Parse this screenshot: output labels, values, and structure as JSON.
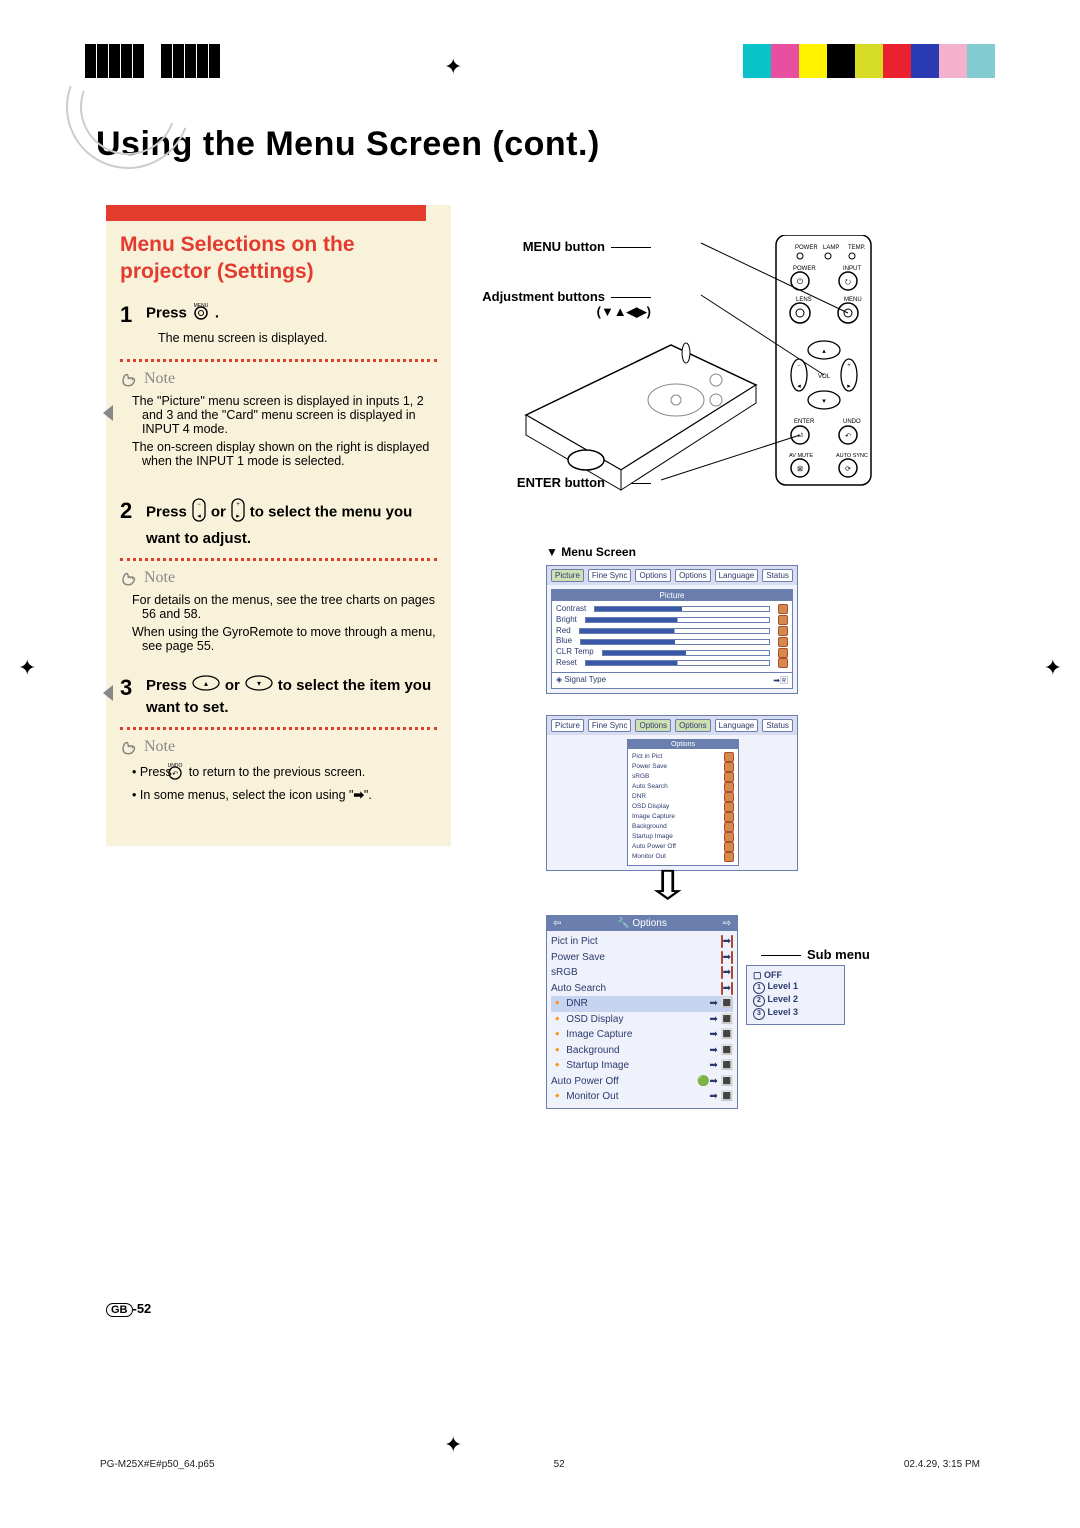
{
  "registration_colors": [
    "#0ac3c8",
    "#e84fa1",
    "#fff200",
    "#000000",
    "#d7dd27",
    "#ea212e",
    "#2a3ab2",
    "#f4b1cb",
    "#82cbd0"
  ],
  "page_title": "Using the Menu Screen (cont.)",
  "section_title": "Menu Selections on the projector (Settings)",
  "step1": {
    "label": "Press ",
    "button_alt": "MENU",
    "after": ".",
    "bullet1": "The menu screen is displayed."
  },
  "note_label": "Note",
  "step1_notes": [
    "The \"Picture\" menu screen is displayed in inputs 1, 2 and 3 and the \"Card\" menu screen is displayed in INPUT 4 mode.",
    "The on-screen display shown on the right is displayed when the INPUT 1 mode is selected."
  ],
  "step2": {
    "pre": "Press ",
    "mid": " or ",
    "post": " to select the menu you want to adjust."
  },
  "step2_notes": [
    "For details on the menus, see the tree charts on pages 56 and 58.",
    "When using the GyroRemote to move through a menu, see page 55."
  ],
  "step3": {
    "pre": "Press ",
    "mid": " or ",
    "post": " to select the item you want to set."
  },
  "step3_notes_a": "Press ",
  "step3_notes_a_alt": "UNDO",
  "step3_notes_a_post": " to return to the previous screen.",
  "step3_notes_b_pre": "In some menus, select the icon using \"",
  "step3_notes_b_post": "\".",
  "right_labels": {
    "menu": "MENU button",
    "adj": "Adjustment buttons",
    "adj_glyphs": "(▼▲◀▶)",
    "enter": "ENTER button",
    "menu_screen": "▼ Menu Screen",
    "submenu": "Sub menu"
  },
  "menu1": {
    "tabs": [
      "Picture",
      "Fine Sync",
      "Options",
      "Options",
      "Language",
      "Status"
    ],
    "active": "Picture",
    "items": [
      "Contrast",
      "Bright",
      "Red",
      "Blue",
      "CLR Temp",
      "Reset"
    ],
    "footer": "Signal Type"
  },
  "menu2": {
    "tabs": [
      "Picture",
      "Fine Sync",
      "Options",
      "Options",
      "Language",
      "Status"
    ],
    "active": "Options",
    "items": [
      "Pict in Pict",
      "Power Save",
      "sRGB",
      "Auto Search",
      "DNR",
      "OSD Display",
      "Image Capture",
      "Background",
      "Startup Image",
      "Auto Power Off",
      "Monitor Out"
    ]
  },
  "menu3": {
    "title": "Options",
    "items": [
      "Pict in Pict",
      "Power Save",
      "sRGB",
      "Auto Search",
      "DNR",
      "OSD Display",
      "Image Capture",
      "Background",
      "Startup Image",
      "Auto Power Off",
      "Monitor Out"
    ]
  },
  "submenu": {
    "items": [
      "OFF",
      "Level 1",
      "Level 2",
      "Level 3"
    ]
  },
  "page_number_label": "-52",
  "page_number_prefix": "GB",
  "footer": {
    "file": "PG-M25X#E#p50_64.p65",
    "page": "52",
    "datetime": "02.4.29, 3:15 PM"
  }
}
